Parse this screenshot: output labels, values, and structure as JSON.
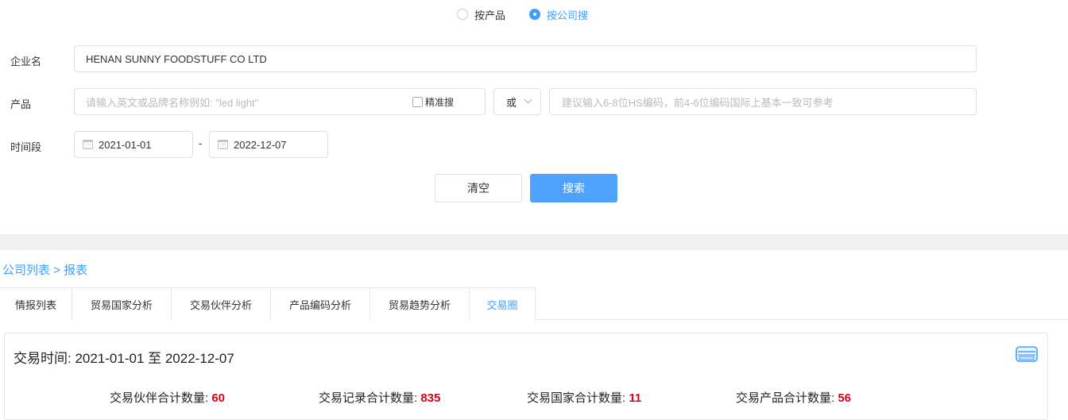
{
  "search_mode": {
    "options": [
      {
        "label": "按产品",
        "selected": false
      },
      {
        "label": "按公司搜",
        "selected": true
      }
    ]
  },
  "form": {
    "company_label": "企业名",
    "company_value": "HENAN SUNNY FOODSTUFF CO LTD",
    "product_label": "产品",
    "product_placeholder": "请输入英文或品牌名称例如: \"led light\"",
    "exact_label": "精准搜",
    "or_value": "或",
    "hs_placeholder": "建议输入6-8位HS编码，前4-6位编码国际上基本一致可参考",
    "period_label": "时间段",
    "date_from": "2021-01-01",
    "date_sep": "-",
    "date_to": "2022-12-07",
    "clear_label": "清空",
    "search_label": "搜索"
  },
  "breadcrumb": "公司列表 > 报表",
  "tabs": [
    {
      "label": "情报列表",
      "active": false
    },
    {
      "label": "贸易国家分析",
      "active": false
    },
    {
      "label": "交易伙伴分析",
      "active": false
    },
    {
      "label": "产品编码分析",
      "active": false
    },
    {
      "label": "贸易趋势分析",
      "active": false
    },
    {
      "label": "交易圈",
      "active": true
    }
  ],
  "summary": {
    "period_text": "交易时间: 2021-01-01 至 2022-12-07",
    "stats": [
      {
        "label": "交易伙伴合计数量: ",
        "value": "60"
      },
      {
        "label": "交易记录合计数量: ",
        "value": "835"
      },
      {
        "label": "交易国家合计数量: ",
        "value": "11"
      },
      {
        "label": "交易产品合计数量: ",
        "value": "56"
      }
    ]
  },
  "colors": {
    "accent": "#409eff",
    "primary_button": "#4fa2fb",
    "stat_number": "#d9001b"
  },
  "icons": {
    "export": "printer-icon",
    "calendar": "calendar-icon"
  }
}
